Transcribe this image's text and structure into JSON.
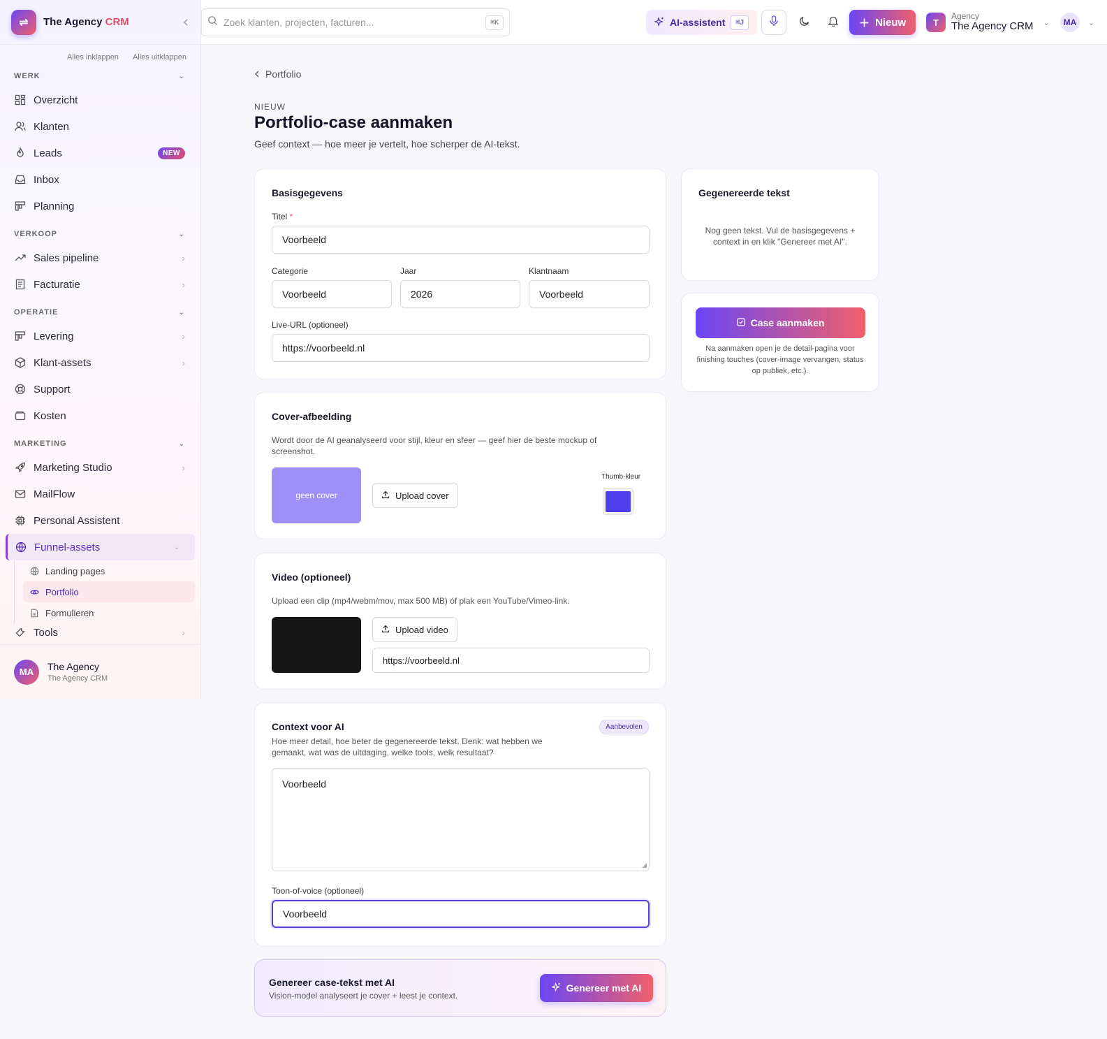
{
  "brand": {
    "name": "The Agency ",
    "name_accent": "CRM",
    "logo_glyph": "⇌"
  },
  "sidebar": {
    "collapse_all": "Alles inklappen",
    "expand_all": "Alles uitklappen",
    "sections": {
      "werk": "WERK",
      "verkoop": "VERKOOP",
      "operatie": "OPERATIE",
      "marketing": "MARKETING"
    },
    "items": {
      "overzicht": "Overzicht",
      "klanten": "Klanten",
      "leads": "Leads",
      "leads_badge": "NEW",
      "inbox": "Inbox",
      "planning": "Planning",
      "sales_pipeline": "Sales pipeline",
      "facturatie": "Facturatie",
      "levering": "Levering",
      "klant_assets": "Klant-assets",
      "support": "Support",
      "kosten": "Kosten",
      "marketing_studio": "Marketing Studio",
      "mailflow": "MailFlow",
      "personal_assistent": "Personal Assistent",
      "funnel_assets": "Funnel-assets",
      "tools": "Tools"
    },
    "sub_items": {
      "landing_pages": "Landing pages",
      "portfolio": "Portfolio",
      "formulieren": "Formulieren"
    },
    "user": {
      "initials": "MA",
      "name": "The Agency",
      "subtitle": "The Agency CRM"
    }
  },
  "topbar": {
    "search_placeholder": "Zoek klanten, projecten, facturen...",
    "search_kbd": "⌘K",
    "ai_label": "AI-assistent",
    "ai_kbd": "⌘J",
    "new_label": "Nieuw",
    "agency_initial": "T",
    "agency_kicker": "Agency",
    "agency_name": "The Agency CRM",
    "user_initials": "MA"
  },
  "page": {
    "breadcrumb": "Portfolio",
    "eyebrow": "NIEUW",
    "title": "Portfolio-case aanmaken",
    "lead": "Geef context — hoe meer je vertelt, hoe scherper de AI-tekst."
  },
  "basis": {
    "title": "Basisgegevens",
    "titel_label": "Titel",
    "titel_req": "*",
    "titel_value": "Voorbeeld",
    "categorie_label": "Categorie",
    "categorie_value": "Voorbeeld",
    "jaar_label": "Jaar",
    "jaar_value": "2026",
    "klantnaam_label": "Klantnaam",
    "klantnaam_value": "Voorbeeld",
    "url_label": "Live-URL (optioneel)",
    "url_value": "https://voorbeeld.nl"
  },
  "cover": {
    "title": "Cover-afbeelding",
    "help": "Wordt door de AI geanalyseerd voor stijl, kleur en sfeer — geef hier de beste mockup of screenshot.",
    "placeholder": "geen cover",
    "upload_label": "Upload cover",
    "thumb_label": "Thumb-kleur",
    "thumb_color": "#4f3df0"
  },
  "video": {
    "title": "Video (optioneel)",
    "help": "Upload een clip (mp4/webm/mov, max 500 MB) óf plak een YouTube/Vimeo-link.",
    "upload_label": "Upload video",
    "url_value": "https://voorbeeld.nl"
  },
  "context": {
    "title": "Context voor AI",
    "badge": "Aanbevolen",
    "help": "Hoe meer detail, hoe beter de gegenereerde tekst. Denk: wat hebben we gemaakt, wat was de uitdaging, welke tools, welk resultaat?",
    "textarea_value": "Voorbeeld",
    "tone_label": "Toon-of-voice (optioneel)",
    "tone_value": "Voorbeeld"
  },
  "generate": {
    "title": "Genereer case-tekst met AI",
    "subtitle": "Vision-model analyseert je cover + leest je context.",
    "button": "Genereer met AI"
  },
  "generated": {
    "title": "Gegenereerde tekst",
    "empty": "Nog geen tekst. Vul de basisgegevens + context in en klik \"Genereer met AI\"."
  },
  "create": {
    "button": "Case aanmaken",
    "note": "Na aanmaken open je de detail-pagina voor finishing touches (cover-image vervangen, status op publiek, etc.)."
  },
  "colors": {
    "accent": "#6b46f5",
    "accent2": "#f0606a",
    "brand_red": "#e0506a"
  }
}
